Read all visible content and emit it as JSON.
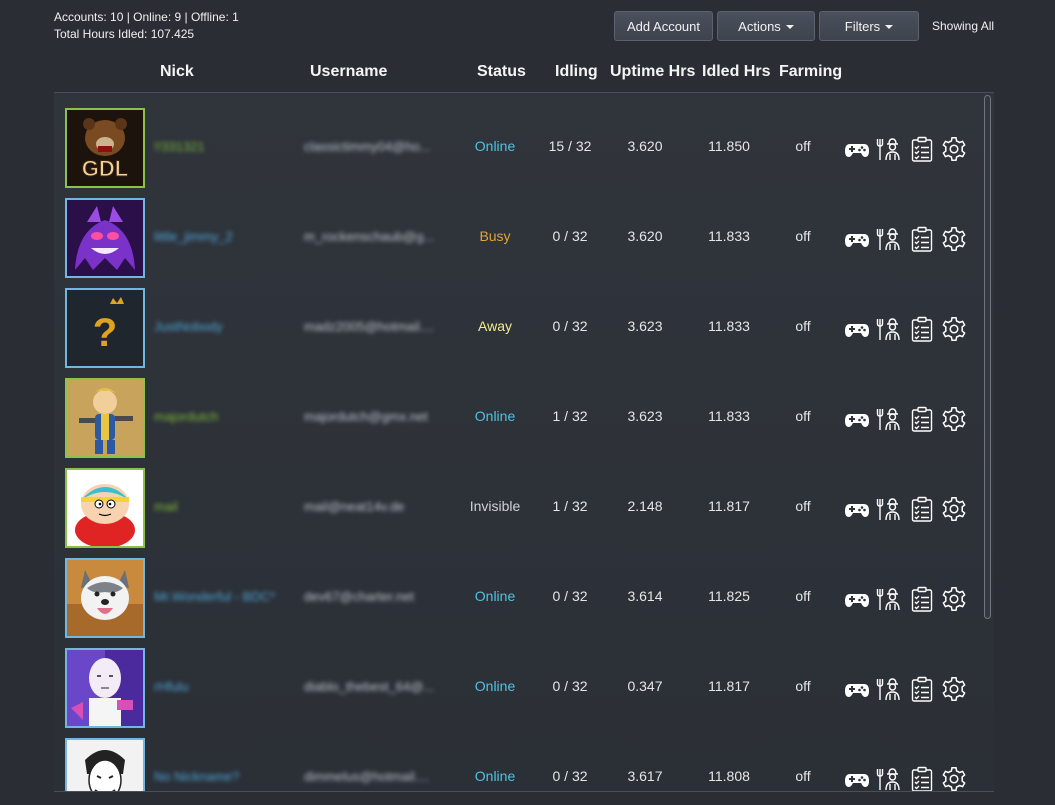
{
  "summary": {
    "accounts_line": "Accounts: 10 | Online: 9 | Offline: 1",
    "hours_line": "Total Hours Idled: 107.425"
  },
  "toolbar": {
    "add_label": "Add Account",
    "actions_label": "Actions",
    "filters_label": "Filters",
    "showing": "Showing All"
  },
  "columns": {
    "nick": "Nick",
    "username": "Username",
    "status": "Status",
    "idling": "Idling",
    "uptime": "Uptime Hrs",
    "idled": "Idled Hrs",
    "farming": "Farming"
  },
  "colors": {
    "online": "#4fc3e6",
    "busy": "#e0a63a",
    "away": "#f1ec8c",
    "invisible": "#cfd2d6",
    "border_green": "#8bc34a",
    "border_blue": "#73b7e0"
  },
  "icons": [
    "gamepad-icon",
    "farmer-icon",
    "clipboard-icon",
    "gear-icon"
  ],
  "rows": [
    {
      "avatar": "bear-gdl-avatar",
      "border": "green",
      "nick": "!!331321",
      "username": "classictimmy04@ho...",
      "status": "Online",
      "idling": "15 / 32",
      "uptime": "3.620",
      "idled": "11.850",
      "farming": "off"
    },
    {
      "avatar": "ghost-avatar",
      "border": "blue",
      "nick": "little_jimmy_2",
      "username": "m_rockenschaub@g...",
      "status": "Busy",
      "idling": "0 / 32",
      "uptime": "3.620",
      "idled": "11.833",
      "farming": "off"
    },
    {
      "avatar": "question-avatar",
      "border": "blue",
      "nick": "JustNobody",
      "username": "madz2005@hotmail....",
      "status": "Away",
      "idling": "0 / 32",
      "uptime": "3.623",
      "idled": "11.833",
      "farming": "off"
    },
    {
      "avatar": "vaultboy-avatar",
      "border": "green",
      "nick": "majordutch",
      "username": "majordutch@gmx.net",
      "status": "Online",
      "idling": "1 / 32",
      "uptime": "3.623",
      "idled": "11.833",
      "farming": "off"
    },
    {
      "avatar": "cartman-avatar",
      "border": "green",
      "nick": "mail",
      "username": "mail@neat14v.de",
      "status": "Invisible",
      "idling": "1 / 32",
      "uptime": "2.148",
      "idled": "11.817",
      "farming": "off"
    },
    {
      "avatar": "husky-avatar",
      "border": "blue",
      "nick": "Mr.Wonderful - BDC*",
      "username": "dev67@charter.net",
      "status": "Online",
      "idling": "0 / 32",
      "uptime": "3.614",
      "idled": "11.825",
      "farming": "off"
    },
    {
      "avatar": "saitama-avatar",
      "border": "blue",
      "nick": "rHfulu",
      "username": "diablo_thebest_64@...",
      "status": "Online",
      "idling": "0 / 32",
      "uptime": "0.347",
      "idled": "11.817",
      "farming": "off"
    },
    {
      "avatar": "joker-avatar",
      "border": "blue",
      "nick": "No Nickname?",
      "username": "dimmelus@hotmail....",
      "status": "Online",
      "idling": "0 / 32",
      "uptime": "3.617",
      "idled": "11.808",
      "farming": "off"
    }
  ]
}
